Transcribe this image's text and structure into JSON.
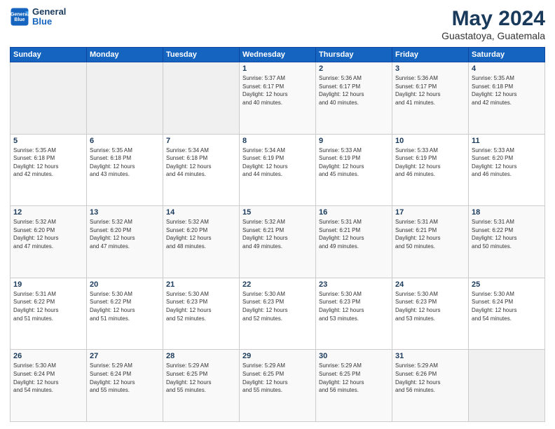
{
  "header": {
    "logo_line1": "General",
    "logo_line2": "Blue",
    "month": "May 2024",
    "location": "Guastatoya, Guatemala"
  },
  "weekdays": [
    "Sunday",
    "Monday",
    "Tuesday",
    "Wednesday",
    "Thursday",
    "Friday",
    "Saturday"
  ],
  "weeks": [
    [
      {
        "day": "",
        "info": ""
      },
      {
        "day": "",
        "info": ""
      },
      {
        "day": "",
        "info": ""
      },
      {
        "day": "1",
        "info": "Sunrise: 5:37 AM\nSunset: 6:17 PM\nDaylight: 12 hours\nand 40 minutes."
      },
      {
        "day": "2",
        "info": "Sunrise: 5:36 AM\nSunset: 6:17 PM\nDaylight: 12 hours\nand 40 minutes."
      },
      {
        "day": "3",
        "info": "Sunrise: 5:36 AM\nSunset: 6:17 PM\nDaylight: 12 hours\nand 41 minutes."
      },
      {
        "day": "4",
        "info": "Sunrise: 5:35 AM\nSunset: 6:18 PM\nDaylight: 12 hours\nand 42 minutes."
      }
    ],
    [
      {
        "day": "5",
        "info": "Sunrise: 5:35 AM\nSunset: 6:18 PM\nDaylight: 12 hours\nand 42 minutes."
      },
      {
        "day": "6",
        "info": "Sunrise: 5:35 AM\nSunset: 6:18 PM\nDaylight: 12 hours\nand 43 minutes."
      },
      {
        "day": "7",
        "info": "Sunrise: 5:34 AM\nSunset: 6:18 PM\nDaylight: 12 hours\nand 44 minutes."
      },
      {
        "day": "8",
        "info": "Sunrise: 5:34 AM\nSunset: 6:19 PM\nDaylight: 12 hours\nand 44 minutes."
      },
      {
        "day": "9",
        "info": "Sunrise: 5:33 AM\nSunset: 6:19 PM\nDaylight: 12 hours\nand 45 minutes."
      },
      {
        "day": "10",
        "info": "Sunrise: 5:33 AM\nSunset: 6:19 PM\nDaylight: 12 hours\nand 46 minutes."
      },
      {
        "day": "11",
        "info": "Sunrise: 5:33 AM\nSunset: 6:20 PM\nDaylight: 12 hours\nand 46 minutes."
      }
    ],
    [
      {
        "day": "12",
        "info": "Sunrise: 5:32 AM\nSunset: 6:20 PM\nDaylight: 12 hours\nand 47 minutes."
      },
      {
        "day": "13",
        "info": "Sunrise: 5:32 AM\nSunset: 6:20 PM\nDaylight: 12 hours\nand 47 minutes."
      },
      {
        "day": "14",
        "info": "Sunrise: 5:32 AM\nSunset: 6:20 PM\nDaylight: 12 hours\nand 48 minutes."
      },
      {
        "day": "15",
        "info": "Sunrise: 5:32 AM\nSunset: 6:21 PM\nDaylight: 12 hours\nand 49 minutes."
      },
      {
        "day": "16",
        "info": "Sunrise: 5:31 AM\nSunset: 6:21 PM\nDaylight: 12 hours\nand 49 minutes."
      },
      {
        "day": "17",
        "info": "Sunrise: 5:31 AM\nSunset: 6:21 PM\nDaylight: 12 hours\nand 50 minutes."
      },
      {
        "day": "18",
        "info": "Sunrise: 5:31 AM\nSunset: 6:22 PM\nDaylight: 12 hours\nand 50 minutes."
      }
    ],
    [
      {
        "day": "19",
        "info": "Sunrise: 5:31 AM\nSunset: 6:22 PM\nDaylight: 12 hours\nand 51 minutes."
      },
      {
        "day": "20",
        "info": "Sunrise: 5:30 AM\nSunset: 6:22 PM\nDaylight: 12 hours\nand 51 minutes."
      },
      {
        "day": "21",
        "info": "Sunrise: 5:30 AM\nSunset: 6:23 PM\nDaylight: 12 hours\nand 52 minutes."
      },
      {
        "day": "22",
        "info": "Sunrise: 5:30 AM\nSunset: 6:23 PM\nDaylight: 12 hours\nand 52 minutes."
      },
      {
        "day": "23",
        "info": "Sunrise: 5:30 AM\nSunset: 6:23 PM\nDaylight: 12 hours\nand 53 minutes."
      },
      {
        "day": "24",
        "info": "Sunrise: 5:30 AM\nSunset: 6:23 PM\nDaylight: 12 hours\nand 53 minutes."
      },
      {
        "day": "25",
        "info": "Sunrise: 5:30 AM\nSunset: 6:24 PM\nDaylight: 12 hours\nand 54 minutes."
      }
    ],
    [
      {
        "day": "26",
        "info": "Sunrise: 5:30 AM\nSunset: 6:24 PM\nDaylight: 12 hours\nand 54 minutes."
      },
      {
        "day": "27",
        "info": "Sunrise: 5:29 AM\nSunset: 6:24 PM\nDaylight: 12 hours\nand 55 minutes."
      },
      {
        "day": "28",
        "info": "Sunrise: 5:29 AM\nSunset: 6:25 PM\nDaylight: 12 hours\nand 55 minutes."
      },
      {
        "day": "29",
        "info": "Sunrise: 5:29 AM\nSunset: 6:25 PM\nDaylight: 12 hours\nand 55 minutes."
      },
      {
        "day": "30",
        "info": "Sunrise: 5:29 AM\nSunset: 6:25 PM\nDaylight: 12 hours\nand 56 minutes."
      },
      {
        "day": "31",
        "info": "Sunrise: 5:29 AM\nSunset: 6:26 PM\nDaylight: 12 hours\nand 56 minutes."
      },
      {
        "day": "",
        "info": ""
      }
    ]
  ]
}
